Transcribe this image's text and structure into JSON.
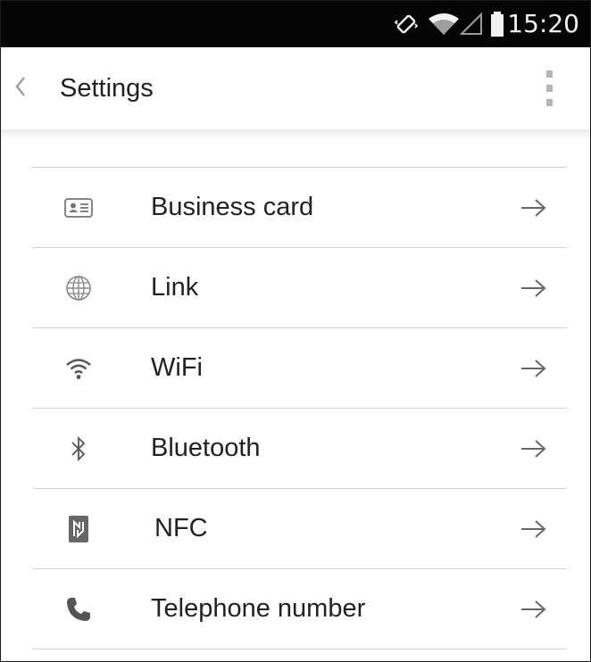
{
  "status_bar": {
    "time": "15:20",
    "icons": [
      "vibrate-icon",
      "wifi-signal-icon",
      "cell-signal-icon",
      "battery-icon"
    ]
  },
  "action_bar": {
    "title": "Settings",
    "back_icon": "chevron-left-icon",
    "overflow_icon": "overflow-menu-icon"
  },
  "settings_list": {
    "items": [
      {
        "label": "Business card",
        "icon": "business-card-icon"
      },
      {
        "label": "Link",
        "icon": "globe-icon"
      },
      {
        "label": "WiFi",
        "icon": "wifi-icon"
      },
      {
        "label": "Bluetooth",
        "icon": "bluetooth-icon"
      },
      {
        "label": "NFC",
        "icon": "nfc-icon"
      },
      {
        "label": "Telephone number",
        "icon": "phone-icon"
      }
    ],
    "arrow_icon": "arrow-right-icon"
  }
}
